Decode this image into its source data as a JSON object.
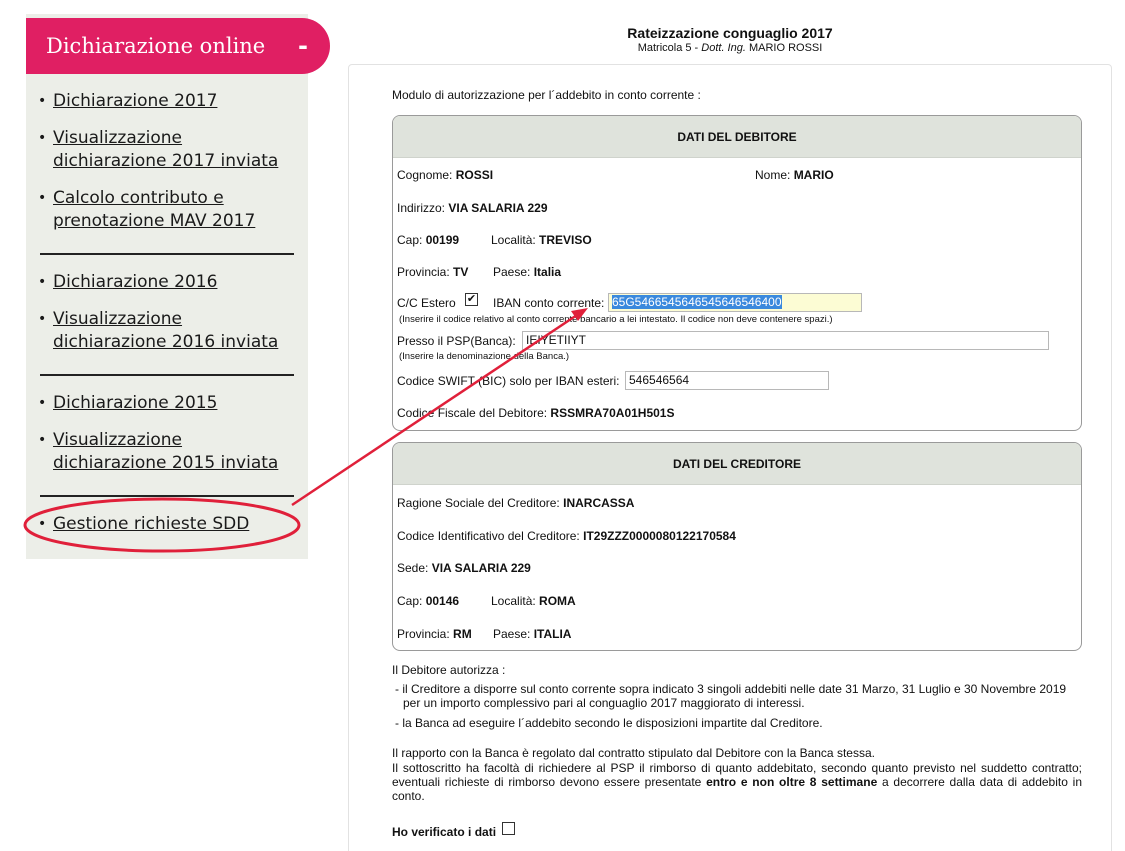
{
  "sidebar": {
    "title": "Dichiarazione online",
    "toggle": "-",
    "groups": [
      [
        {
          "label": "Dichiarazione 2017"
        },
        {
          "label": "Visualizzazione dichiarazione 2017 inviata"
        },
        {
          "label": "Calcolo contributo e prenotazione MAV 2017"
        }
      ],
      [
        {
          "label": "Dichiarazione 2016"
        },
        {
          "label": "Visualizzazione dichiarazione 2016 inviata"
        }
      ],
      [
        {
          "label": "Dichiarazione 2015"
        },
        {
          "label": "Visualizzazione dichiarazione 2015 inviata"
        }
      ],
      [
        {
          "label": "Gestione richieste SDD"
        }
      ]
    ]
  },
  "header": {
    "title": "Rateizzazione conguaglio 2017",
    "matricola": "Matricola 5 - ",
    "qualifica": "Dott. Ing.",
    "nome": " MARIO ROSSI"
  },
  "intro": "Modulo di autorizzazione per l´addebito in conto corrente :",
  "debitore": {
    "title": "DATI DEL DEBITORE",
    "cognome_label": "Cognome:",
    "cognome": "ROSSI",
    "nome_label": "Nome:",
    "nome": "MARIO",
    "indirizzo_label": "Indirizzo:",
    "indirizzo": "VIA SALARIA 229",
    "cap_label": "Cap:",
    "cap": "00199",
    "localita_label": "Località:",
    "localita": "TREVISO",
    "provincia_label": "Provincia:",
    "provincia": "TV",
    "paese_label": "Paese:",
    "paese": "Italia",
    "cc_estero_label": "C/C Estero",
    "cc_estero_checked": true,
    "iban_label": "IBAN conto corrente:",
    "iban_value": "65G5466545646545646546400",
    "iban_note": "(Inserire il codice relativo al conto corrente bancario a lei intestato. Il codice non deve contenere spazi.)",
    "psp_label": "Presso il PSP(Banca):",
    "psp_value": "IEIYETIIYT",
    "psp_note": "(Inserire la denominazione della Banca.)",
    "swift_label": "Codice SWIFT (BIC) solo per IBAN esteri:",
    "swift_value": "546546564",
    "cf_label": "Codice Fiscale del Debitore:",
    "cf": "RSSMRA70A01H501S"
  },
  "creditore": {
    "title": "DATI DEL CREDITORE",
    "ragione_label": "Ragione Sociale del Creditore:",
    "ragione": "INARCASSA",
    "codice_label": "Codice Identificativo del Creditore:",
    "codice": "IT29ZZZ0000080122170584",
    "sede_label": "Sede:",
    "sede": "VIA SALARIA 229",
    "cap_label": "Cap:",
    "cap": "00146",
    "localita_label": "Località:",
    "localita": "ROMA",
    "provincia_label": "Provincia:",
    "provincia": "RM",
    "paese_label": "Paese:",
    "paese": "ITALIA"
  },
  "autorizza": {
    "heading": "Il Debitore autorizza :",
    "item1": "- il Creditore a disporre sul conto corrente sopra indicato 3 singoli addebiti nelle date 31 Marzo, 31 Luglio e 30 Novembre 2019 per un importo complessivo pari al conguaglio 2017 maggiorato di interessi.",
    "item2": "- la Banca ad eseguire l´addebito secondo le disposizioni impartite dal Creditore.",
    "rapporto1": "Il rapporto con la Banca è regolato dal contratto stipulato dal Debitore con la Banca stessa.",
    "rapporto2a": "Il sottoscritto ha facoltà di richiedere al PSP il rimborso di quanto addebitato, secondo quanto previsto nel suddetto contratto; eventuali richieste di rimborso devono essere presentate ",
    "rapporto2b": "entro e non oltre 8 settimane",
    "rapporto2c": " a decorrere dalla data di addebito in conto."
  },
  "verify": {
    "label": "Ho verificato i dati",
    "checked": false
  },
  "colors": {
    "accent": "#e01f63",
    "annotation": "#e0203a",
    "sidebar_bg": "#eceee8",
    "box_header_bg": "#dfe3dc"
  }
}
